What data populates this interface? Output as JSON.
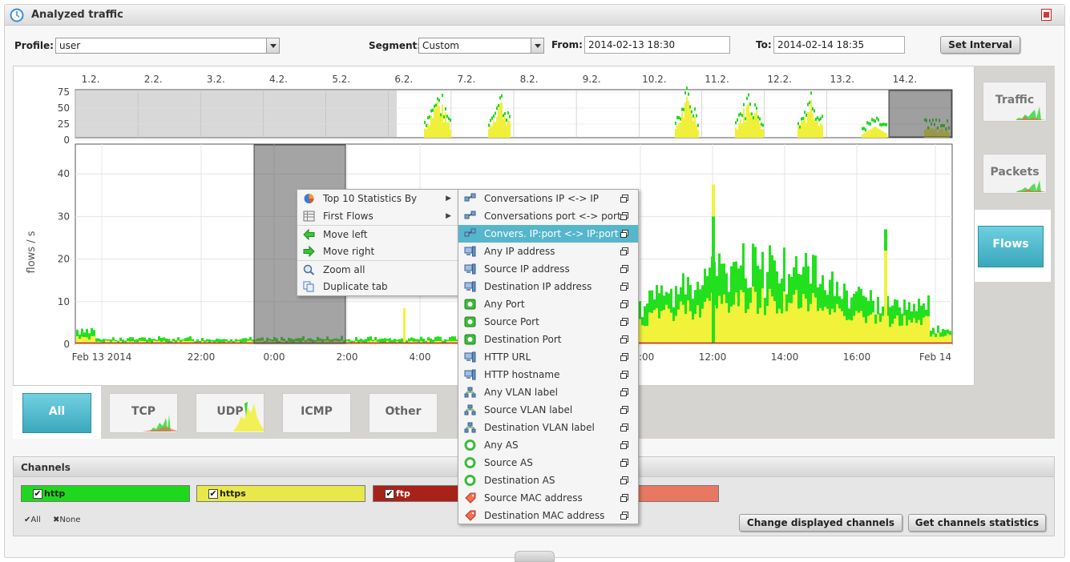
{
  "window": {
    "title": "Analyzed traffic"
  },
  "controls": {
    "profile_label": "Profile:",
    "profile_value": "user",
    "segment_label": "Segment:",
    "segment_value": "Custom",
    "from_label": "From:",
    "from_value": "2014-02-13 18:30",
    "to_label": "To:",
    "to_value": "2014-02-14 18:35",
    "set_interval": "Set Interval"
  },
  "overview": {
    "dates": [
      "1.2.",
      "2.2.",
      "3.2.",
      "4.2.",
      "5.2.",
      "6.2.",
      "7.2.",
      "8.2.",
      "9.2.",
      "10.2.",
      "11.2.",
      "12.2.",
      "13.2.",
      "14.2."
    ],
    "y_ticks": [
      "75",
      "50",
      "25",
      "0"
    ]
  },
  "chart_data": {
    "type": "area",
    "ylabel": "flows / s",
    "ylim": [
      0,
      47
    ],
    "y_ticks": [
      "40",
      "30",
      "20",
      "10",
      "0"
    ],
    "x_ticks": [
      "Feb 13 2014",
      "22:00",
      "0:00",
      "2:00",
      "4:00",
      "10:00",
      "12:00",
      "14:00",
      "16:00",
      "Feb 14"
    ],
    "selected_range_x": [
      "23:30",
      "02:00"
    ],
    "series": [
      {
        "name": "http",
        "color": "#22e01e"
      },
      {
        "name": "https",
        "color": "#f2f23a"
      },
      {
        "name": "ftp",
        "color": "#c82525"
      }
    ]
  },
  "right_tabs": [
    "Traffic",
    "Packets",
    "Flows"
  ],
  "bottom_tabs": [
    "All",
    "TCP",
    "UDP",
    "ICMP",
    "Other"
  ],
  "channels": {
    "title": "Channels",
    "items": [
      {
        "label": "http",
        "color": "#1ed81e"
      },
      {
        "label": "https",
        "color": "#e8e84a"
      },
      {
        "label": "ftp",
        "color": "#a8221a"
      },
      {
        "label": "",
        "color": "#e87862"
      }
    ],
    "all": "All",
    "none": "None",
    "change_btn": "Change displayed channels",
    "stats_btn": "Get channels statistics"
  },
  "context_menu": {
    "items": [
      {
        "label": "Top 10 Statistics By",
        "icon": "pie-chart-icon"
      },
      {
        "label": "First Flows",
        "icon": "table-icon"
      },
      {
        "label": "Move left",
        "icon": "arrow-left-icon"
      },
      {
        "label": "Move right",
        "icon": "arrow-right-icon"
      },
      {
        "label": "Zoom all",
        "icon": "magnifier-icon"
      },
      {
        "label": "Duplicate tab",
        "icon": "duplicate-icon"
      }
    ]
  },
  "submenu": {
    "items": [
      {
        "label": "Conversations IP <-> IP",
        "icon": "network-pair-icon"
      },
      {
        "label": "Conversations port <-> port",
        "icon": "network-pair-icon"
      },
      {
        "label": "Convers. IP:port <-> IP:port",
        "icon": "network-pair-icon"
      },
      {
        "label": "Any IP address",
        "icon": "computer-icon"
      },
      {
        "label": "Source IP address",
        "icon": "computer-icon"
      },
      {
        "label": "Destination IP address",
        "icon": "computer-icon"
      },
      {
        "label": "Any Port",
        "icon": "green-port-icon"
      },
      {
        "label": "Source Port",
        "icon": "green-port-icon"
      },
      {
        "label": "Destination Port",
        "icon": "green-port-icon"
      },
      {
        "label": "HTTP URL",
        "icon": "computer-icon"
      },
      {
        "label": "HTTP hostname",
        "icon": "computer-icon"
      },
      {
        "label": "Any VLAN label",
        "icon": "vlan-icon"
      },
      {
        "label": "Source VLAN label",
        "icon": "vlan-icon"
      },
      {
        "label": "Destination VLAN label",
        "icon": "vlan-icon"
      },
      {
        "label": "Any AS",
        "icon": "green-ring-icon"
      },
      {
        "label": "Source AS",
        "icon": "green-ring-icon"
      },
      {
        "label": "Destination AS",
        "icon": "green-ring-icon"
      },
      {
        "label": "Source MAC address",
        "icon": "tag-icon"
      },
      {
        "label": "Destination MAC address",
        "icon": "tag-icon"
      }
    ]
  }
}
